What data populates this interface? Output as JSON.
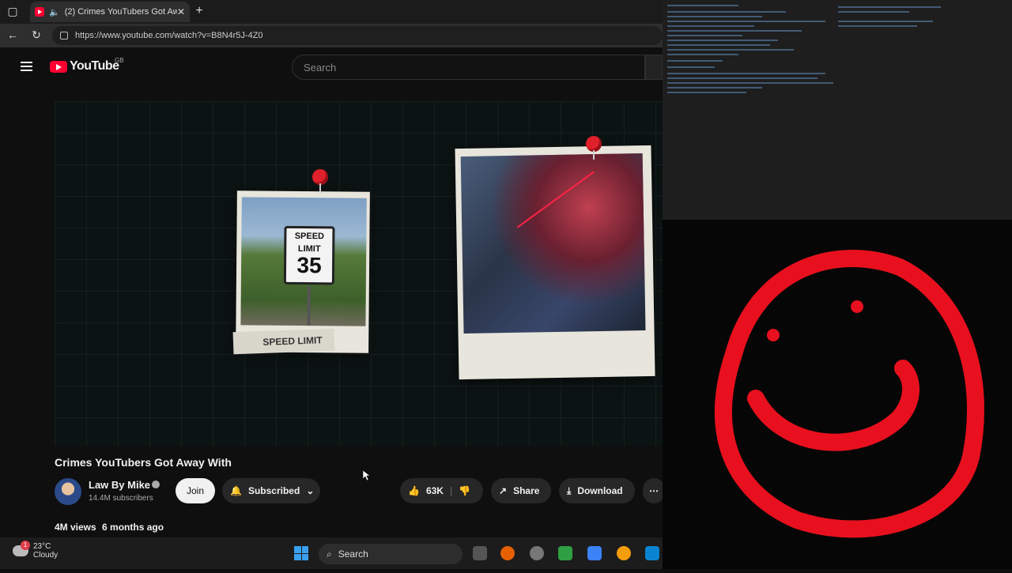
{
  "browser": {
    "tab_title": "(2) Crimes YouTubers Got Aw",
    "url": "https://www.youtube.com/watch?v=B8N4r5J-4Z0"
  },
  "youtube": {
    "logo_text": "YouTube",
    "region": "GB",
    "search_placeholder": "Search"
  },
  "video": {
    "sign_line1": "SPEED",
    "sign_line2": "LIMIT",
    "sign_number": "35",
    "tag_label": "SPEED LIMIT",
    "title": "Crimes YouTubers Got Away With",
    "channel": "Law By Mike",
    "subscribers": "14.4M subscribers",
    "join_label": "Join",
    "subscribed_label": "Subscribed",
    "likes": "63K",
    "share_label": "Share",
    "download_label": "Download",
    "views": "4M views",
    "age": "6 months ago"
  },
  "taskbar": {
    "notification_count": "1",
    "temperature": "23°C",
    "condition": "Cloudy",
    "search_label": "Search"
  },
  "colors": {
    "youtube_red": "#ff0033",
    "smiley_red": "#e8101e",
    "background": "#0f0f0f"
  }
}
